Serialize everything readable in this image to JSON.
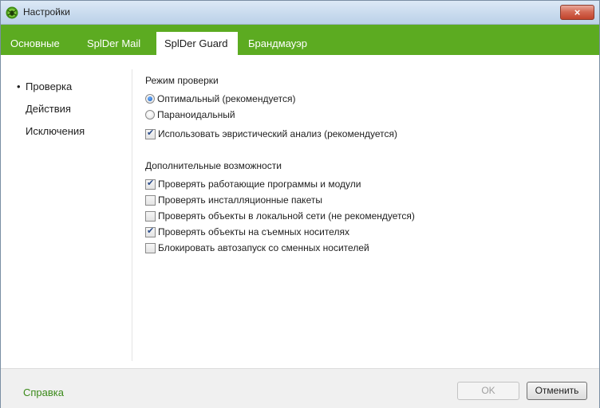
{
  "window": {
    "title": "Настройки",
    "close_glyph": "×",
    "icon": "spider-guard-icon"
  },
  "tabs": [
    {
      "label": "Основные",
      "active": false
    },
    {
      "label": "SplDer Mail",
      "active": false
    },
    {
      "label": "SplDer Guard",
      "active": true
    },
    {
      "label": "Брандмауэр",
      "active": false
    }
  ],
  "nav": {
    "bullet": "•",
    "items": [
      {
        "label": "Проверка",
        "selected": true
      },
      {
        "label": "Действия",
        "selected": false
      },
      {
        "label": "Исключения",
        "selected": false
      }
    ]
  },
  "scan_mode": {
    "title": "Режим проверки",
    "options": [
      {
        "label": "Оптимальный (рекомендуется)",
        "selected": true
      },
      {
        "label": "Параноидальный",
        "selected": false
      }
    ],
    "heuristic": {
      "label": "Использовать эвристический анализ (рекомендуется)",
      "checked": true
    }
  },
  "extra": {
    "title": "Дополнительные возможности",
    "options": [
      {
        "label": "Проверять работающие программы и модули",
        "checked": true
      },
      {
        "label": "Проверять инсталляционные пакеты",
        "checked": false
      },
      {
        "label": "Проверять объекты в локальной сети (не рекомендуется)",
        "checked": false
      },
      {
        "label": "Проверять объекты на съемных носителях",
        "checked": true
      },
      {
        "label": "Блокировать автозапуск со сменных носителей",
        "checked": false
      }
    ]
  },
  "footer": {
    "help_label": "Справка",
    "ok_label": "OK",
    "ok_enabled": false,
    "cancel_label": "Отменить"
  },
  "colors": {
    "accent_green": "#5cab21",
    "help_link": "#3b8a1a",
    "close_red": "#c1442c"
  }
}
